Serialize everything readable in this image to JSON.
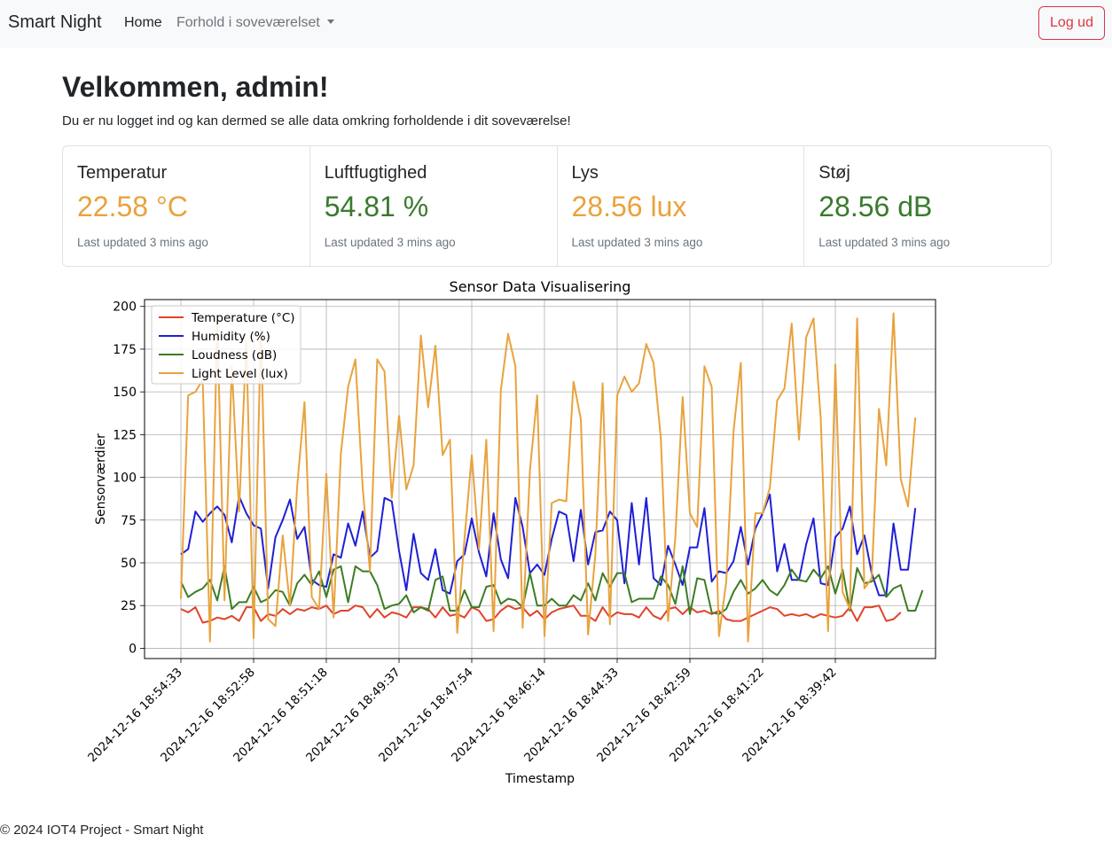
{
  "nav": {
    "brand": "Smart Night",
    "home": "Home",
    "dropdown": "Forhold i soveværelset",
    "logout": "Log ud"
  },
  "welcome": {
    "title": "Velkommen, admin!",
    "text": "Du er nu logget ind og kan dermed se alle data omkring forholdende i dit soveværelse!"
  },
  "cards": [
    {
      "title": "Temperatur",
      "value": "22.58 °C",
      "updated": "Last updated 3 mins ago",
      "color": "#e8a33d"
    },
    {
      "title": "Luftfugtighed",
      "value": "54.81 %",
      "updated": "Last updated 3 mins ago",
      "color": "#3a7a2e"
    },
    {
      "title": "Lys",
      "value": "28.56 lux",
      "updated": "Last updated 3 mins ago",
      "color": "#e8a33d"
    },
    {
      "title": "Støj",
      "value": "28.56 dB",
      "updated": "Last updated 3 mins ago",
      "color": "#3a7a2e"
    }
  ],
  "chart_data": {
    "type": "line",
    "title": "Sensor Data Visualisering",
    "xlabel": "Timestamp",
    "ylabel": "Sensorværdier",
    "ylim": [
      -6,
      204
    ],
    "yticks": [
      0,
      25,
      50,
      75,
      100,
      125,
      150,
      175,
      200
    ],
    "n_points": 100,
    "xticks": [
      {
        "index": 0,
        "label": "2024-12-16 18:54:33"
      },
      {
        "index": 10,
        "label": "2024-12-16 18:52:58"
      },
      {
        "index": 20,
        "label": "2024-12-16 18:51:18"
      },
      {
        "index": 30,
        "label": "2024-12-16 18:49:37"
      },
      {
        "index": 40,
        "label": "2024-12-16 18:47:54"
      },
      {
        "index": 50,
        "label": "2024-12-16 18:46:14"
      },
      {
        "index": 60,
        "label": "2024-12-16 18:44:33"
      },
      {
        "index": 70,
        "label": "2024-12-16 18:42:59"
      },
      {
        "index": 80,
        "label": "2024-12-16 18:41:22"
      },
      {
        "index": 90,
        "label": "2024-12-16 18:39:42"
      }
    ],
    "grid": true,
    "legend_position": "top-left",
    "series": [
      {
        "name": "Temperature (°C)",
        "color": "#e0442a",
        "values": [
          23,
          21,
          24,
          15,
          16,
          18,
          17,
          19,
          16,
          24,
          24,
          16,
          20,
          19,
          23,
          20,
          23,
          22,
          24,
          23,
          25,
          20,
          22,
          22,
          25,
          24,
          18,
          23,
          18,
          21,
          20,
          18,
          24,
          24,
          23,
          18,
          24,
          19,
          20,
          18,
          24,
          22,
          16,
          17,
          22,
          25,
          23,
          24,
          19,
          22,
          17,
          21,
          23,
          24,
          25,
          19,
          19,
          16,
          24,
          18,
          21,
          20,
          20,
          18,
          24,
          19,
          17,
          23,
          24,
          20,
          24,
          21,
          22,
          20,
          22,
          17,
          16,
          16,
          18,
          20,
          22,
          24,
          23,
          19,
          20,
          19,
          20,
          18,
          20,
          19,
          18,
          19,
          24,
          16,
          24,
          24,
          25,
          16,
          17,
          21
        ]
      },
      {
        "name": "Humidity (%)",
        "color": "#1f1fd6",
        "values": [
          55,
          58,
          80,
          74,
          79,
          83,
          78,
          62,
          89,
          79,
          72,
          70,
          35,
          65,
          75,
          87,
          64,
          71,
          40,
          37,
          36,
          55,
          53,
          73,
          60,
          80,
          53,
          57,
          88,
          86,
          57,
          34,
          67,
          44,
          40,
          58,
          34,
          32,
          51,
          55,
          76,
          56,
          42,
          79,
          52,
          41,
          88,
          71,
          44,
          49,
          43,
          64,
          80,
          78,
          51,
          81,
          49,
          68,
          69,
          80,
          75,
          38,
          85,
          49,
          88,
          41,
          37,
          60,
          49,
          37,
          59,
          59,
          82,
          39,
          45,
          44,
          51,
          71,
          49,
          70,
          79,
          90,
          45,
          61,
          40,
          40,
          61,
          76,
          38,
          37,
          65,
          70,
          83,
          55,
          66,
          44,
          31,
          31,
          73,
          46,
          46,
          82
        ]
      },
      {
        "name": "Loudness (dB)",
        "color": "#3b7d23",
        "values": [
          39,
          30,
          33,
          35,
          40,
          28,
          48,
          23,
          27,
          27,
          36,
          27,
          29,
          34,
          33,
          25,
          38,
          43,
          37,
          45,
          30,
          46,
          48,
          27,
          48,
          45,
          45,
          37,
          23,
          25,
          26,
          31,
          21,
          24,
          22,
          40,
          42,
          22,
          22,
          34,
          24,
          24,
          36,
          37,
          26,
          29,
          28,
          24,
          44,
          25,
          25,
          29,
          25,
          25,
          31,
          28,
          38,
          28,
          44,
          36,
          44,
          44,
          27,
          29,
          29,
          29,
          42,
          37,
          26,
          48,
          20,
          41,
          40,
          21,
          20,
          23,
          33,
          40,
          32,
          35,
          40,
          34,
          31,
          37,
          46,
          40,
          39,
          46,
          41,
          48,
          32,
          46,
          22,
          47,
          38,
          39,
          43,
          30,
          35,
          37,
          22,
          22,
          34
        ]
      },
      {
        "name": "Light Level (lux)",
        "color": "#e8a33d",
        "values": [
          29,
          148,
          150,
          157,
          4,
          191,
          28,
          165,
          80,
          180,
          6,
          187,
          17,
          13,
          66,
          25,
          95,
          144,
          30,
          23,
          102,
          18,
          114,
          153,
          169,
          94,
          45,
          169,
          162,
          88,
          136,
          93,
          107,
          183,
          141,
          177,
          113,
          122,
          9,
          64,
          113,
          58,
          122,
          10,
          151,
          184,
          165,
          12,
          104,
          148,
          7,
          85,
          87,
          86,
          156,
          134,
          8,
          55,
          155,
          14,
          148,
          159,
          150,
          155,
          178,
          167,
          123,
          16,
          65,
          147,
          79,
          71,
          165,
          153,
          7,
          39,
          127,
          167,
          4,
          79,
          79,
          94,
          145,
          152,
          190,
          122,
          182,
          193,
          134,
          10,
          166,
          33,
          23,
          193,
          35,
          41,
          140,
          107,
          196,
          99,
          83,
          135
        ]
      }
    ]
  },
  "footer": "© 2024 IOT4 Project - Smart Night"
}
